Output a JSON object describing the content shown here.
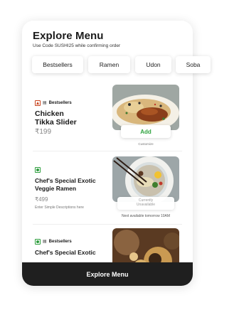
{
  "header": {
    "title": "Explore Menu",
    "subtitle": "Use Code SUSHI25 while confirming order"
  },
  "categories": [
    "Bestsellers",
    "Ramen",
    "Udon",
    "Soba"
  ],
  "items": [
    {
      "badge": "Bestsellers",
      "diet": "non-veg",
      "name_line1": "Chicken",
      "name_line2": "Tikka Slider",
      "price": "₹199",
      "action_label": "Add",
      "action_subtext": "Customize"
    },
    {
      "diet": "veg",
      "name": "Chef's Special Exotic Veggie Ramen",
      "price": "₹499",
      "description": "Enter Simple Descriptions here",
      "status_line1": "Currently",
      "status_line2": "Unavailable",
      "status_subtext": "Next available tomorrow 10AM"
    },
    {
      "badge": "Bestsellers",
      "diet": "veg",
      "name": "Chef's Special Exotic"
    }
  ],
  "footer": {
    "button_label": "Explore Menu"
  },
  "colors": {
    "accent_green": "#2fa33f",
    "nonveg": "#c8441f",
    "bar": "#1f1f1f"
  },
  "icons": [
    "nonveg-indicator-icon",
    "veg-indicator-icon",
    "bestseller-icon"
  ]
}
